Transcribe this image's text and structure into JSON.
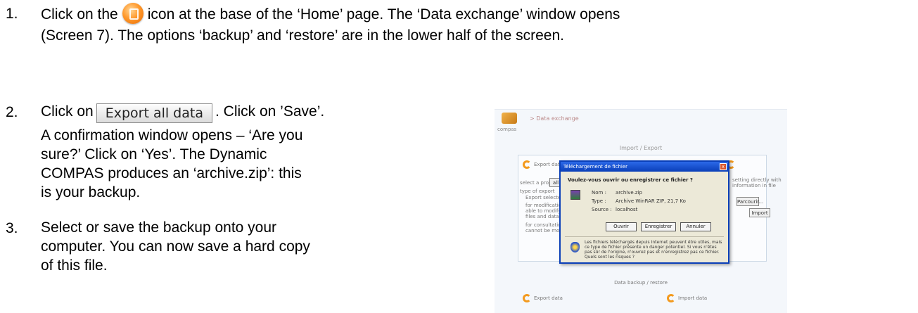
{
  "steps": [
    {
      "number": "1.",
      "text_before_icon": "Click on the",
      "text_after_icon": "icon at the base of the ‘Home’ page. The ‘Data exchange’ window opens",
      "line2": "(Screen 7). The options ‘backup’ and ‘restore’ are in the lower half of the screen.",
      "icon": "orange-round-home-icon"
    },
    {
      "number": "2.",
      "text_before_button": "Click on",
      "button_label": "Export all data",
      "text_after_button": ". Click on ’Save’.",
      "lines": [
        "A confirmation window opens – ‘Are you",
        "sure?’ Click on ‘Yes’. The Dynamic",
        "COMPAS produces an ‘archive.zip’: this",
        "is your backup."
      ]
    },
    {
      "number": "3.",
      "lines": [
        "Select or save the backup onto your",
        "computer. You can now save a hard copy",
        "of this file."
      ]
    }
  ],
  "screenshot": {
    "logo_word": "compas",
    "breadcrumb": "> Data exchange",
    "section_title": "Import / Export",
    "lower_section_title": "Data backup / restore",
    "left_panel_title": "Export data",
    "select_label": "select a project:",
    "select_value": "all",
    "left_lines": [
      "type of export",
      "Export selected item",
      "for modification on",
      "able to modify your",
      "files and data records",
      "for consultation only",
      "cannot be modified"
    ],
    "right_lines": [
      "setting directly with",
      "information in file"
    ],
    "right_buttons": [
      "Parcourir...",
      "Import"
    ],
    "bottom_left": "Export data",
    "bottom_right": "Import data",
    "dialog": {
      "title": "Téléchargement de fichier",
      "close": "x",
      "question": "Voulez-vous ouvrir ou enregistrer ce fichier ?",
      "name_label": "Nom :",
      "name_value": "archive.zip",
      "type_label": "Type :",
      "type_value": "Archive WinRAR ZIP, 21,7 Ko",
      "from_label": "Source :",
      "from_value": "localhost",
      "buttons": [
        "Ouvrir",
        "Enregistrer",
        "Annuler"
      ],
      "warning": "Les fichiers téléchargés depuis Internet peuvent être utiles, mais ce type de fichier présente un danger potentiel. Si vous n'êtes pas sûr de l'origine, n'ouvrez pas et n'enregistrez pas ce fichier. Quels sont les risques ?"
    }
  }
}
